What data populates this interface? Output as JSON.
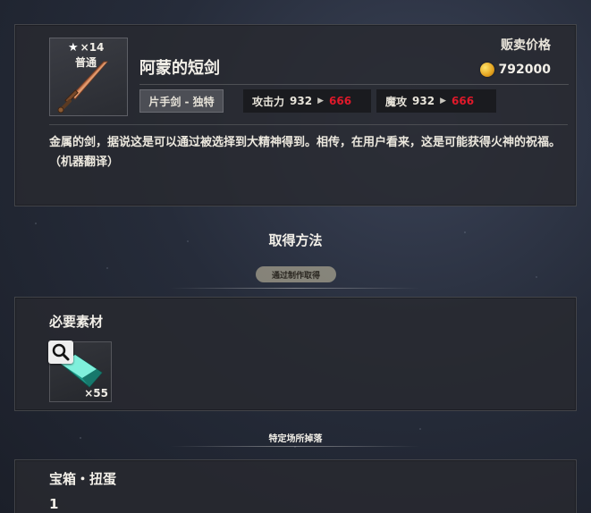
{
  "item": {
    "rarity_count": "×14",
    "rarity_name": "普通",
    "name": "阿蒙的短剑",
    "sell_label": "贩卖价格",
    "sell_price": "792000",
    "type_tag": "片手剑 - 独特",
    "stats": [
      {
        "label": "攻击力",
        "old": "932",
        "new": "666"
      },
      {
        "label": "魔攻",
        "old": "932",
        "new": "666"
      }
    ],
    "description": "金属的剑，据说这是可以通过被选择到大精神得到。相传，在用户看来，这是可能获得火神的祝福。（机器翻译）"
  },
  "acquisition": {
    "title": "取得方法",
    "subtitle": "通过制作取得"
  },
  "materials": {
    "title": "必要素材",
    "items": [
      {
        "icon": "crystal-ingot-icon",
        "count": "×55"
      }
    ]
  },
  "drop": {
    "title": "特定场所掉落"
  },
  "treasure": {
    "title": "宝箱・扭蛋",
    "count": "1"
  },
  "colors": {
    "stat_new": "#e0192a",
    "panel_bg": "#282a30",
    "coin": "#e3a21f"
  }
}
